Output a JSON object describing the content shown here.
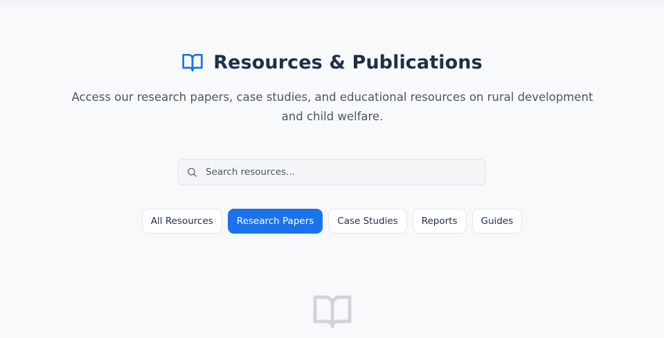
{
  "header": {
    "title": "Resources & Publications",
    "subtitle": "Access our research papers, case studies, and educational resources on rural development and child welfare.",
    "icon": "book-open-icon"
  },
  "search": {
    "placeholder": "Search resources...",
    "value": "",
    "icon": "search-icon"
  },
  "filters": [
    {
      "label": "All Resources",
      "active": false
    },
    {
      "label": "Research Papers",
      "active": true
    },
    {
      "label": "Case Studies",
      "active": false
    },
    {
      "label": "Reports",
      "active": false
    },
    {
      "label": "Guides",
      "active": false
    }
  ],
  "empty_state": {
    "icon": "book-open-icon"
  },
  "colors": {
    "accent": "#1a73e8",
    "title": "#1e2f47",
    "background": "#f8f9fb",
    "empty_icon": "#d1d5db"
  }
}
